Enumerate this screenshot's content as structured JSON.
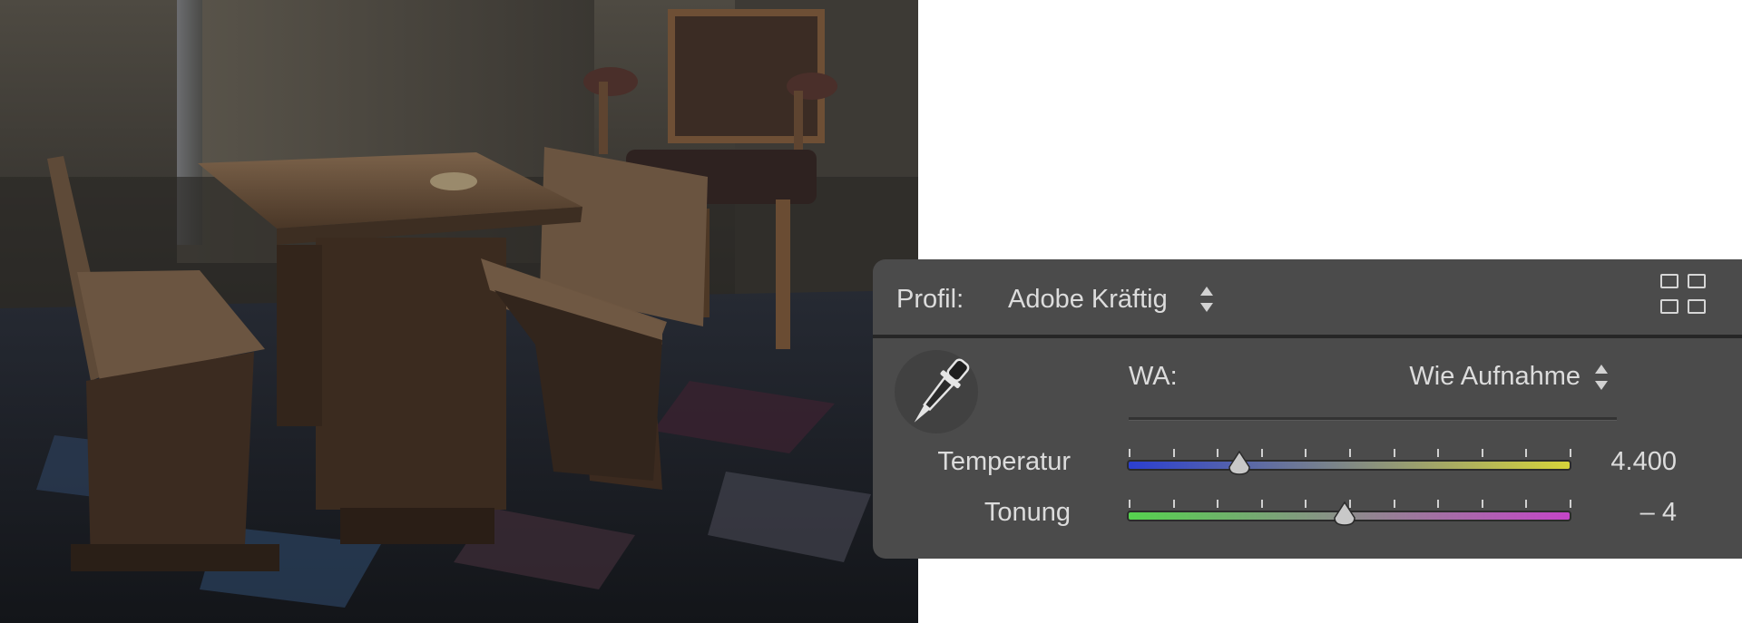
{
  "panel": {
    "profile_label": "Profil:",
    "profile_value": "Adobe Kräftig",
    "wb_label": "WA:",
    "wb_value": "Wie Aufnahme",
    "sliders": [
      {
        "label": "Temperatur",
        "value": "4.400",
        "position": 0.25,
        "gradient": [
          "#2b3fd0",
          "#d6d33a"
        ]
      },
      {
        "label": "Tonung",
        "value": "– 4",
        "position": 0.49,
        "gradient": [
          "#55d24e",
          "#c445c8"
        ]
      }
    ],
    "icons": {
      "eyedropper": "eyedropper-icon",
      "profile_browser": "grid-icon",
      "updown": "updown-arrows-icon"
    },
    "colors": {
      "panel_bg": "#4b4b4b",
      "text": "#dcdcdc"
    }
  }
}
